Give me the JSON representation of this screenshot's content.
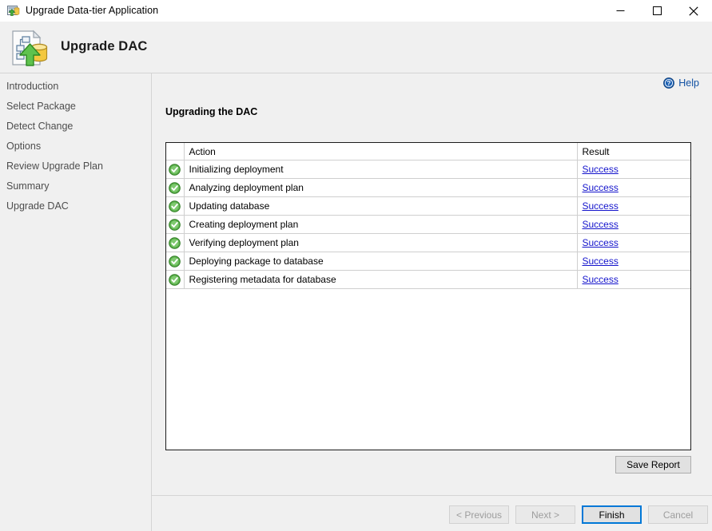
{
  "window": {
    "title": "Upgrade Data-tier Application",
    "icon": "upgrade-dac-icon",
    "controls": {
      "minimize": "minimize-icon",
      "maximize": "maximize-icon",
      "close": "close-icon"
    }
  },
  "banner": {
    "title": "Upgrade DAC",
    "icon": "dac-package-icon"
  },
  "sidebar": {
    "items": [
      {
        "label": "Introduction"
      },
      {
        "label": "Select Package"
      },
      {
        "label": "Detect Change"
      },
      {
        "label": "Options"
      },
      {
        "label": "Review Upgrade Plan"
      },
      {
        "label": "Summary"
      },
      {
        "label": "Upgrade DAC"
      }
    ]
  },
  "help": {
    "label": "Help",
    "icon": "help-question-icon"
  },
  "main": {
    "step_title": "Upgrading the DAC",
    "grid": {
      "columns": [
        "",
        "Action",
        "Result"
      ],
      "rows": [
        {
          "status": "success-icon",
          "action": "Initializing deployment",
          "result": "Success"
        },
        {
          "status": "success-icon",
          "action": "Analyzing deployment plan",
          "result": "Success"
        },
        {
          "status": "success-icon",
          "action": "Updating database",
          "result": "Success"
        },
        {
          "status": "success-icon",
          "action": "Creating deployment plan",
          "result": "Success"
        },
        {
          "status": "success-icon",
          "action": "Verifying deployment plan",
          "result": "Success"
        },
        {
          "status": "success-icon",
          "action": "Deploying package to database",
          "result": "Success"
        },
        {
          "status": "success-icon",
          "action": "Registering metadata for database",
          "result": "Success"
        }
      ]
    },
    "save_report_label": "Save Report"
  },
  "footer": {
    "previous_label": "< Previous",
    "next_label": "Next >",
    "finish_label": "Finish",
    "cancel_label": "Cancel"
  },
  "colors": {
    "accent": "#0078d7",
    "link": "#1414cc",
    "help_link": "#1251a3",
    "success": "#4caf3f",
    "window_bg": "#f0f0f0"
  }
}
